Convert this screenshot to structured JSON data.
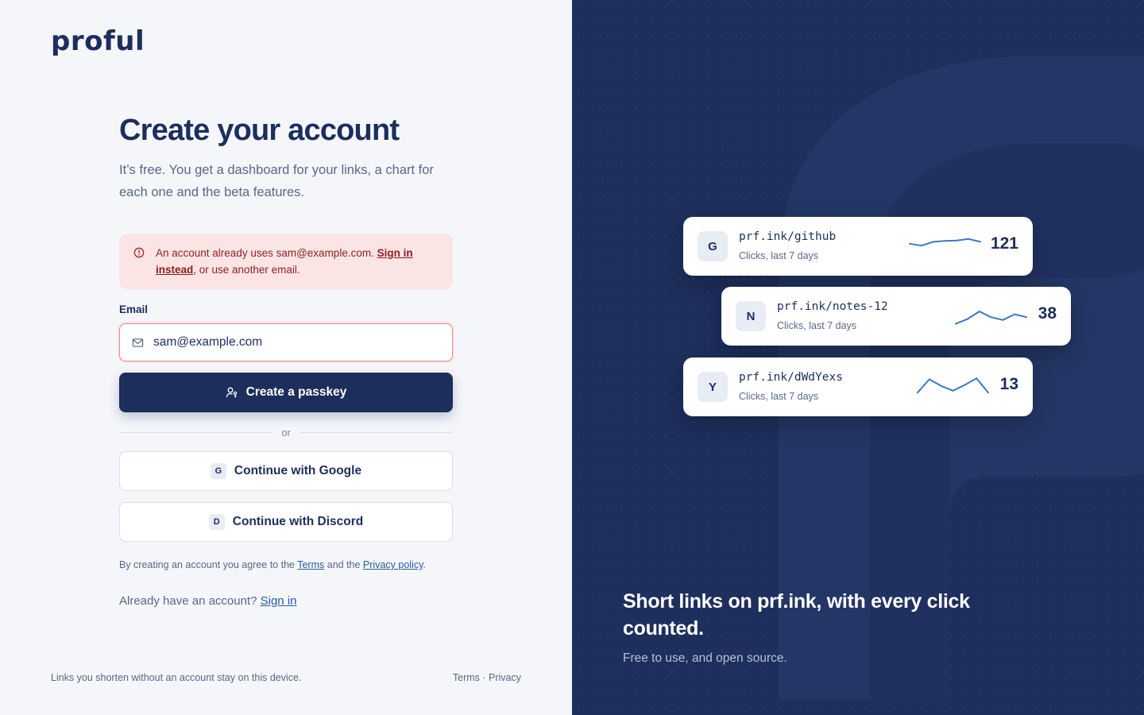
{
  "brand": {
    "logo": "proful"
  },
  "signup": {
    "title": "Create your account",
    "subtitle": "It’s free. You get a dashboard for your links, a chart for each one and the beta features.",
    "alert": {
      "prefix": "An account already uses sam@example.com. ",
      "link": "Sign in instead",
      "suffix": ", or use another email."
    },
    "email_label": "Email",
    "email_value": "sam@example.com",
    "passkey_button": "Create a passkey",
    "divider": "or",
    "google": {
      "badge": "G",
      "label": "Continue with Google"
    },
    "discord": {
      "badge": "D",
      "label": "Continue with Discord"
    },
    "terms": {
      "prefix": "By creating an account you agree to the ",
      "terms_link": "Terms",
      "mid": " and the ",
      "privacy_link": "Privacy policy",
      "suffix": "."
    },
    "already": {
      "prefix": "Already have an account? ",
      "link": "Sign in"
    }
  },
  "footer": {
    "note": "Links you shorten without an account stay on this device.",
    "terms": "Terms",
    "sep": " · ",
    "privacy": "Privacy"
  },
  "showcase": {
    "cards": [
      {
        "avatar": "G",
        "url": "prf.ink/github",
        "meta": "Clicks, last 7 days",
        "count": "121",
        "spark": [
          0.55,
          0.45,
          0.65,
          0.7,
          0.72,
          0.8,
          0.65
        ]
      },
      {
        "avatar": "N",
        "url": "prf.ink/notes-12",
        "meta": "Clicks, last 7 days",
        "count": "38",
        "spark": [
          0.1,
          0.35,
          0.75,
          0.45,
          0.3,
          0.6,
          0.45
        ]
      },
      {
        "avatar": "Y",
        "url": "prf.ink/dWdYexs",
        "meta": "Clicks, last 7 days",
        "count": "13",
        "spark": [
          0.2,
          0.9,
          0.55,
          0.3,
          0.6,
          0.95,
          0.2
        ]
      }
    ],
    "tagline": "Short links on prf.ink, with every click counted.",
    "sub_tagline": "Free to use, and open source.",
    "colors": {
      "panel": "#1e2f5d",
      "spark": "#3b78c4"
    }
  }
}
